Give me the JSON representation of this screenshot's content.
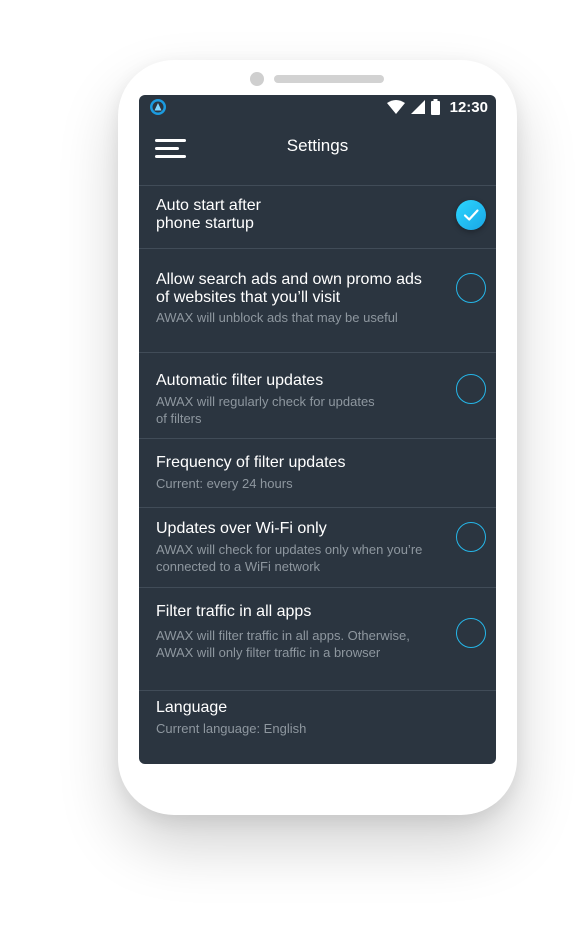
{
  "status_bar": {
    "time": "12:30",
    "icons": [
      "wifi-icon",
      "signal-icon",
      "battery-icon"
    ]
  },
  "toolbar": {
    "title": "Settings",
    "menu_icon": "hamburger-menu-icon"
  },
  "colors": {
    "screen_bg": "#2b3540",
    "accent": "#25b6e8",
    "divider": "#414c58",
    "subtitle": "#8e979f"
  },
  "settings": [
    {
      "title_line1": "Auto start after",
      "title_line2": "phone startup",
      "checked": true
    },
    {
      "title_line1": "Allow search ads and own promo ads",
      "title_line2": "of websites that you’ll visit",
      "subtitle_line1": "AWAX will unblock ads that may be useful",
      "checked": false
    },
    {
      "title_line1": "Automatic filter updates",
      "subtitle_line1": "AWAX will regularly check for updates",
      "subtitle_line2": "of filters",
      "checked": false
    },
    {
      "title_line1": "Frequency of filter updates",
      "subtitle_line1": "Current: every 24 hours"
    },
    {
      "title_line1": "Updates over Wi-Fi only",
      "subtitle_line1": "AWAX will check for updates only when you’re",
      "subtitle_line2": "connected to a WiFi network",
      "checked": false
    },
    {
      "title_line1": "Filter traffic in all apps",
      "subtitle_line1": "AWAX will filter traffic in all apps. Otherwise,",
      "subtitle_line2": "AWAX will only filter traffic in a browser",
      "checked": false
    },
    {
      "title_line1": "Language",
      "subtitle_line1": "Current language: English"
    }
  ]
}
